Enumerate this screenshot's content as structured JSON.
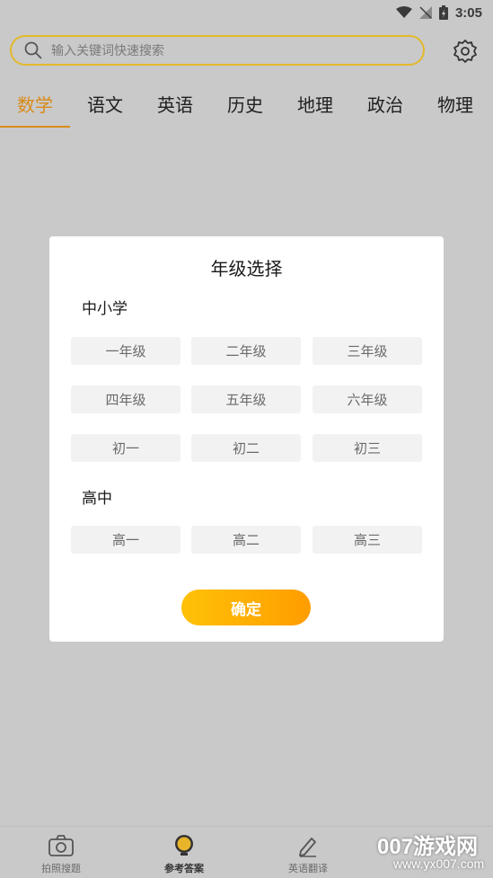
{
  "status_bar": {
    "time": "3:05"
  },
  "search": {
    "placeholder": "输入关键词快速搜索"
  },
  "tabs": [
    {
      "label": "数学",
      "active": true
    },
    {
      "label": "语文"
    },
    {
      "label": "英语"
    },
    {
      "label": "历史"
    },
    {
      "label": "地理"
    },
    {
      "label": "政治"
    },
    {
      "label": "物理"
    }
  ],
  "dialog": {
    "title": "年级选择",
    "sections": [
      {
        "title": "中小学",
        "options": [
          "一年级",
          "二年级",
          "三年级",
          "四年级",
          "五年级",
          "六年级",
          "初一",
          "初二",
          "初三"
        ]
      },
      {
        "title": "高中",
        "options": [
          "高一",
          "高二",
          "高三"
        ]
      }
    ],
    "confirm_label": "确定"
  },
  "bottom_nav": [
    {
      "label": "拍照搜题",
      "icon": "camera-icon"
    },
    {
      "label": "参考答案",
      "icon": "bulb-icon",
      "active": true
    },
    {
      "label": "英语翻译",
      "icon": "pencil-icon"
    }
  ],
  "watermark": {
    "main": "007游戏网",
    "sub": "www.yx007.com"
  },
  "colors": {
    "accent": "#d98b1a",
    "search_border": "#e3b92a",
    "button_start": "#ffc107",
    "button_end": "#ff9d00"
  }
}
